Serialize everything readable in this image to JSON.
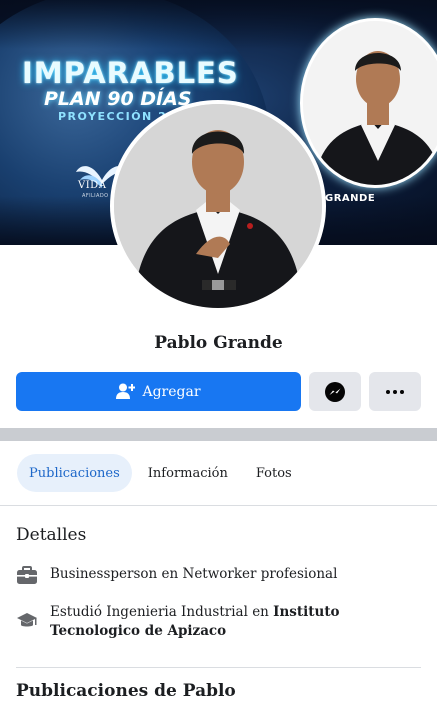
{
  "cover": {
    "headline": "IMPARABLES",
    "subheadline": "PLAN 90 DÍAS",
    "tagline": "PROYECCIÓN 20",
    "brand": "VIDA",
    "brand_small": "AFILIADO",
    "ring_name": "GRANDE"
  },
  "profile": {
    "name": "Pablo Grande"
  },
  "actions": {
    "add_label": "Agregar"
  },
  "tabs": [
    {
      "label": "Publicaciones",
      "active": true
    },
    {
      "label": "Información",
      "active": false
    },
    {
      "label": "Fotos",
      "active": false
    }
  ],
  "details": {
    "title": "Detalles",
    "work": "Businessperson en Networker profesional",
    "study_prefix": "Estudió Ingenieria Industrial en ",
    "study_school": "Instituto Tecnologico de Apizaco"
  },
  "posts": {
    "title": "Publicaciones de Pablo"
  },
  "colors": {
    "primary": "#1877f2",
    "secondary_button": "#e4e6eb",
    "active_tab_bg": "#e7f0fb",
    "active_tab_text": "#1d67c9",
    "divider": "#c9ccd1"
  },
  "icons": {
    "add": "person-add-icon",
    "messenger": "messenger-icon",
    "more": "more-dots-icon",
    "work": "briefcase-icon",
    "education": "graduation-cap-icon"
  }
}
